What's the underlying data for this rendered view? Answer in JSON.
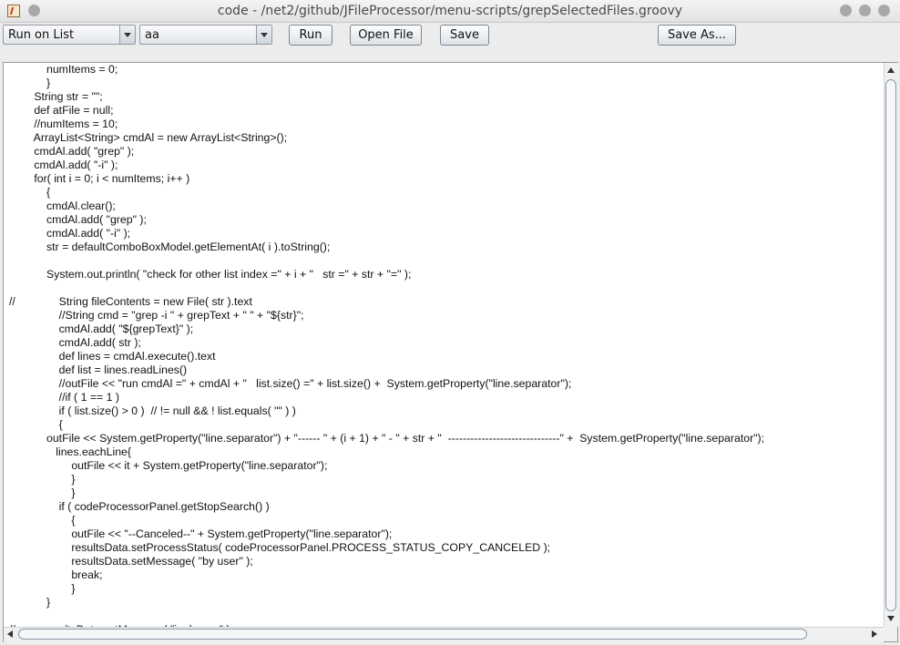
{
  "window": {
    "title": "code - /net2/github/JFileProcessor/menu-scripts/grepSelectedFiles.groovy"
  },
  "toolbar": {
    "run_mode_selected": "Run on List",
    "text_selected": "aa",
    "run_label": "Run",
    "open_file_label": "Open File",
    "save_label": "Save",
    "save_as_label": "Save As..."
  },
  "editor": {
    "lines": [
      "            numItems = 0;",
      "            }",
      "        String str = \"\";",
      "        def atFile = null;",
      "        //numItems = 10;",
      "        ArrayList<String> cmdAl = new ArrayList<String>();",
      "        cmdAl.add( \"grep\" );",
      "        cmdAl.add( \"-i\" );",
      "        for( int i = 0; i < numItems; i++ )",
      "            {",
      "            cmdAl.clear();",
      "            cmdAl.add( \"grep\" );",
      "            cmdAl.add( \"-i\" );",
      "            str = defaultComboBoxModel.getElementAt( i ).toString();",
      "",
      "            System.out.println( \"check for other list index =\" + i + \"   str =\" + str + \"=\" );",
      "",
      "//              String fileContents = new File( str ).text",
      "                //String cmd = \"grep -i \" + grepText + \" \" + \"${str}\";",
      "                cmdAl.add( \"${grepText}\" );",
      "                cmdAl.add( str );",
      "                def lines = cmdAl.execute().text",
      "                def list = lines.readLines()",
      "                //outFile << \"run cmdAl =\" + cmdAl + \"   list.size() =\" + list.size() +  System.getProperty(\"line.separator\");",
      "                //if ( 1 == 1 )",
      "                if ( list.size() > 0 )  // != null && ! list.equals( \"\" ) )",
      "                {",
      "            outFile << System.getProperty(\"line.separator\") + \"------ \" + (i + 1) + \" - \" + str + \"  ------------------------------\" +  System.getProperty(\"line.separator\");",
      "               lines.eachLine{",
      "                    outFile << it + System.getProperty(\"line.separator\");",
      "                    }",
      "                    }",
      "                if ( codeProcessorPanel.getStopSearch() )",
      "                    {",
      "                    outFile << \"--Canceled--\" + System.getProperty(\"line.separator\");",
      "                    resultsData.setProcessStatus( codeProcessorPanel.PROCESS_STATUS_COPY_CANCELED );",
      "                    resultsData.setMessage( \"by user\" );",
      "                    break;",
      "                    }",
      "            }",
      "",
      "//         resultsData.setMessage( \"junk msg\" );"
    ]
  }
}
